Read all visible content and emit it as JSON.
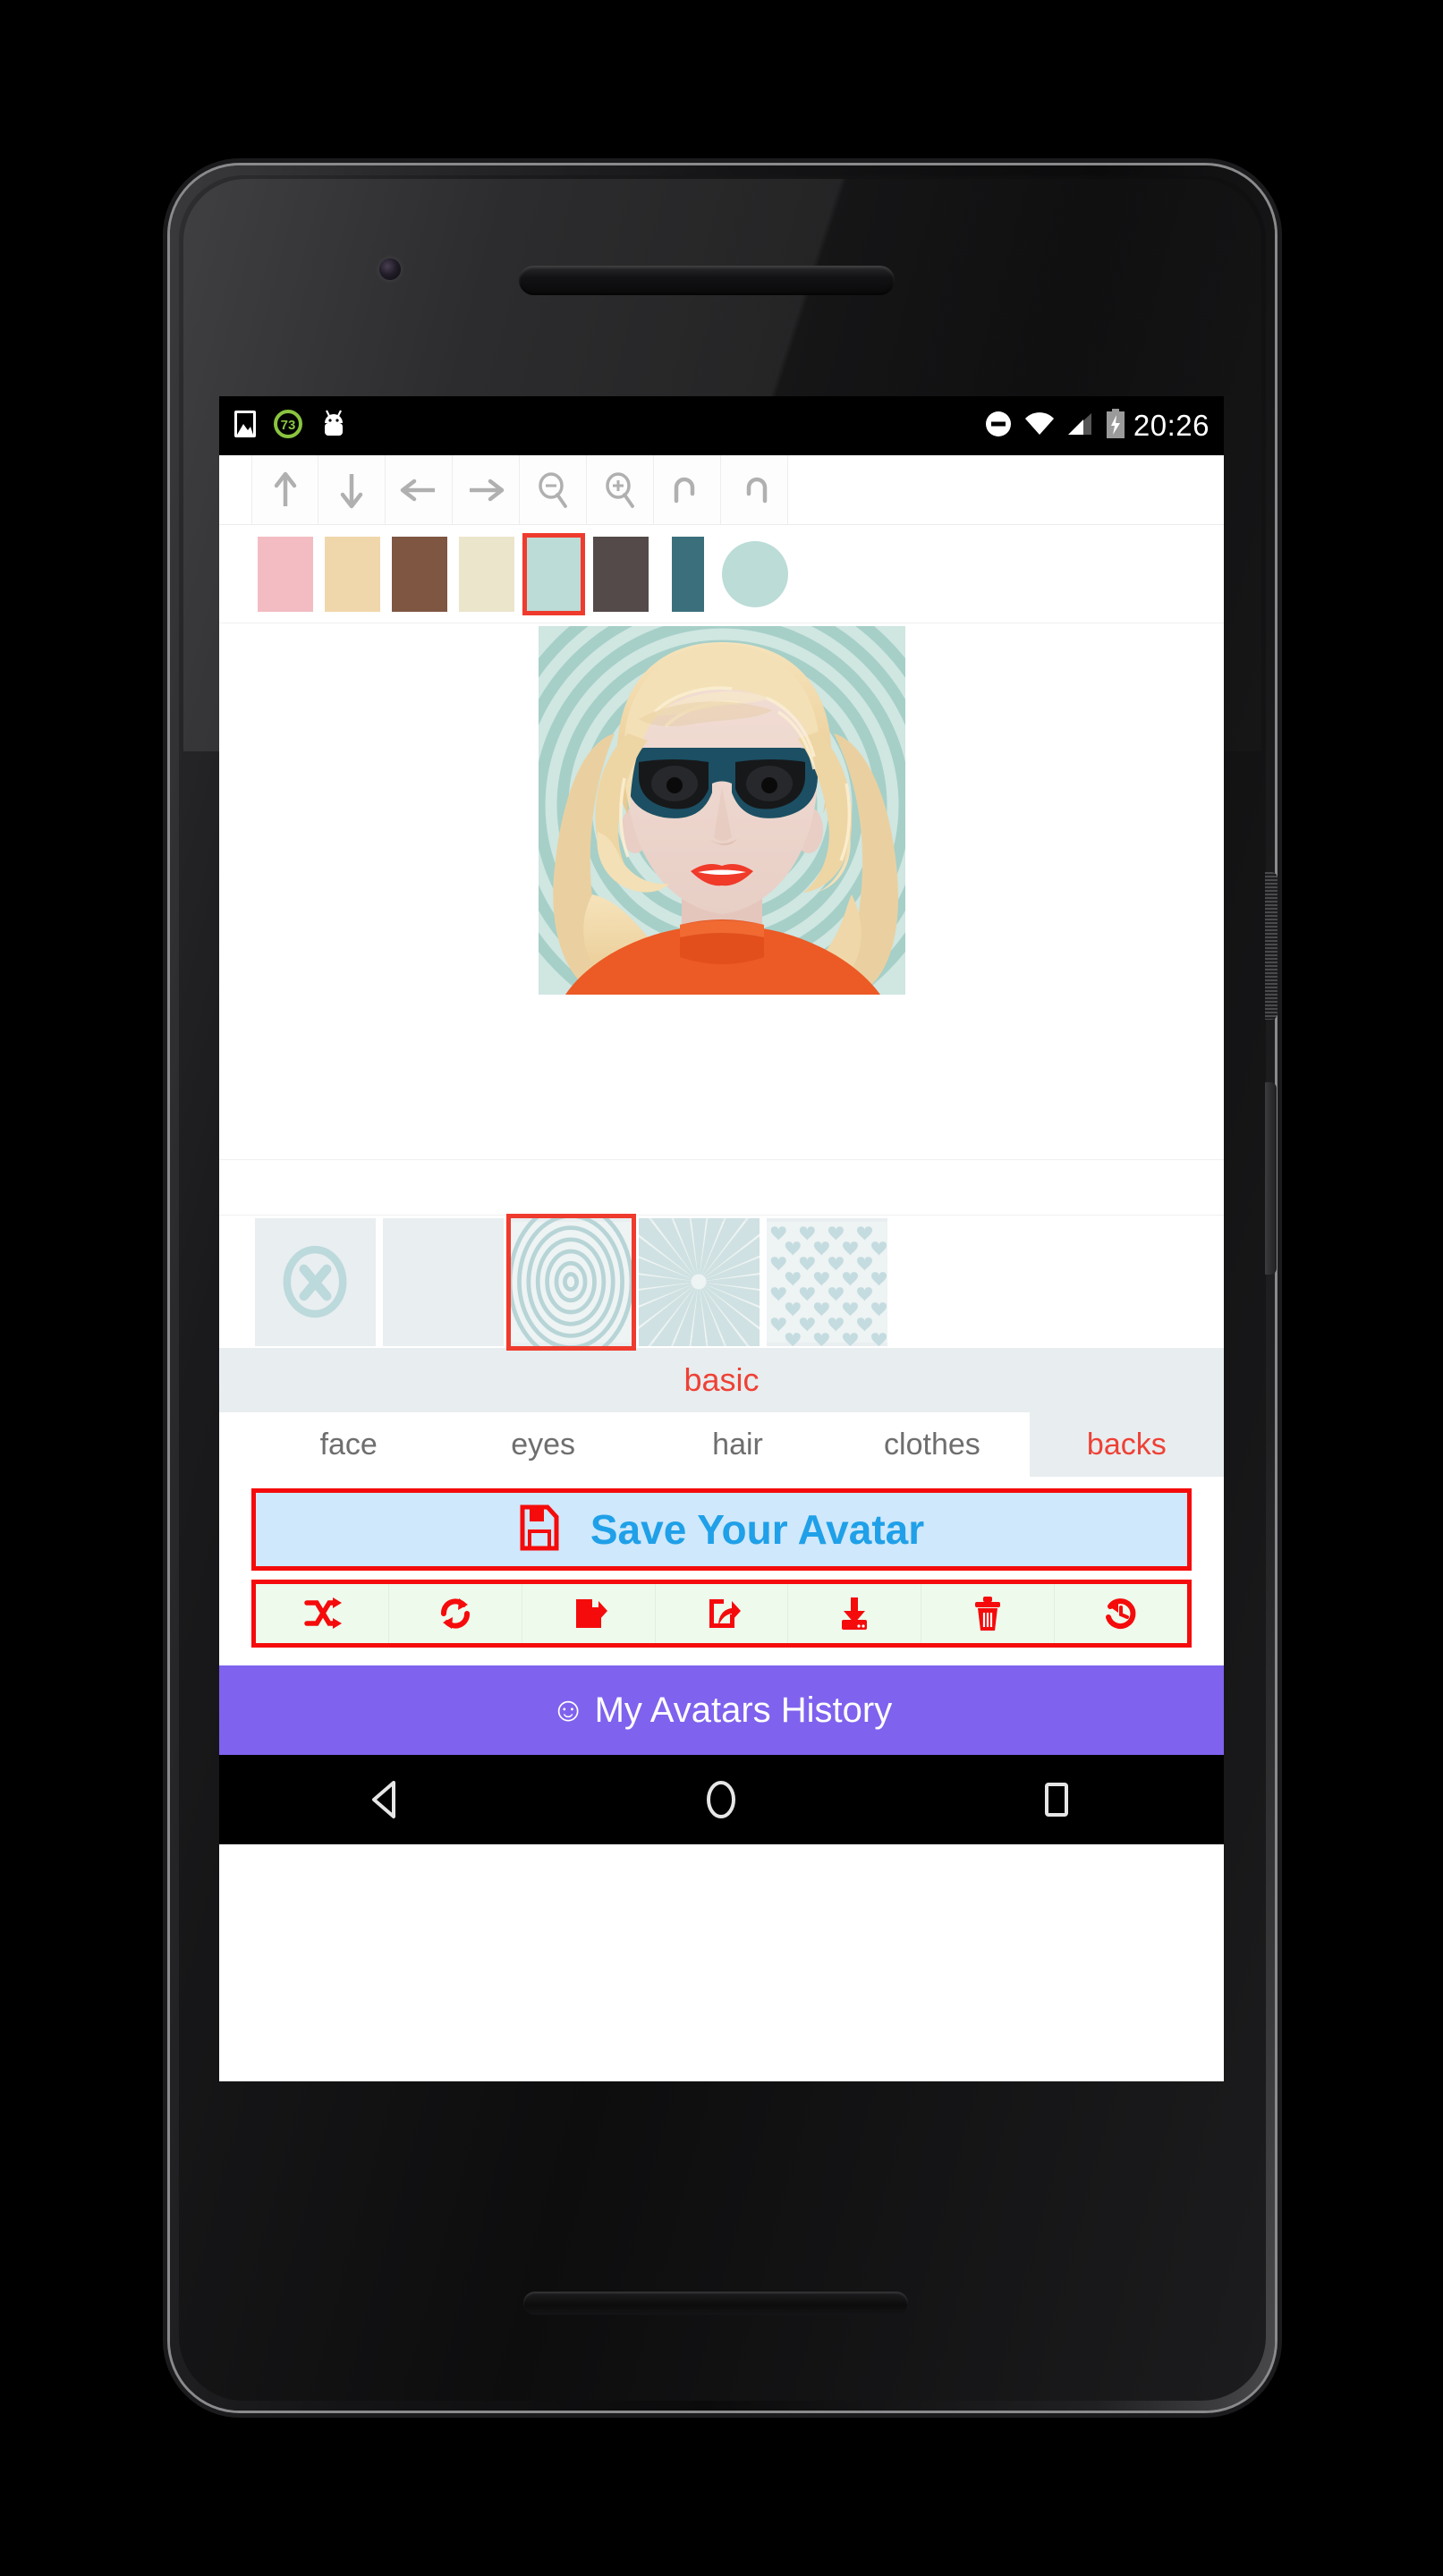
{
  "device": {
    "status_bar": {
      "time": "20:26",
      "left_icons": [
        "image-icon",
        "battery-saver-73-icon",
        "android-robot-icon"
      ],
      "battery_level": "73",
      "right_icons": [
        "do-not-disturb-icon",
        "wifi-icon",
        "cell-signal-icon",
        "battery-charging-icon"
      ]
    },
    "nav_bar": {
      "back": "back-triangle-icon",
      "home": "home-circle-icon",
      "recents": "recents-square-icon"
    }
  },
  "editor_toolbar": {
    "buttons": [
      {
        "name": "move-up",
        "icon": "arrow-up-icon"
      },
      {
        "name": "move-down",
        "icon": "arrow-down-icon"
      },
      {
        "name": "move-left",
        "icon": "arrow-left-icon"
      },
      {
        "name": "move-right",
        "icon": "arrow-right-icon"
      },
      {
        "name": "zoom-out",
        "icon": "magnifier-minus-icon"
      },
      {
        "name": "zoom-in",
        "icon": "magnifier-plus-icon"
      },
      {
        "name": "undo",
        "icon": "undo-icon"
      },
      {
        "name": "redo",
        "icon": "redo-icon"
      }
    ]
  },
  "color_palette": {
    "selected_index": 4,
    "current_color": "#bbdcd7",
    "swatches": [
      {
        "name": "pink",
        "hex": "#f2bcc2"
      },
      {
        "name": "tan",
        "hex": "#f0d7ab"
      },
      {
        "name": "brown",
        "hex": "#7e5642"
      },
      {
        "name": "cream",
        "hex": "#eae5cb"
      },
      {
        "name": "light-teal",
        "hex": "#bbdcd7"
      },
      {
        "name": "dark-gray",
        "hex": "#544a4a"
      },
      {
        "name": "teal",
        "hex": "#3c6f7c"
      }
    ]
  },
  "avatar": {
    "background_style": "concentric-rings",
    "background_color": "#b9dcd6",
    "hair_color": "#f0d7a6",
    "skin_color": "#efd9d0",
    "sunglasses_color": "#1c4f63",
    "lips_color": "#f03a2a",
    "shirt_color": "#ec5a25"
  },
  "background_thumbnails": {
    "selected_index": 2,
    "items": [
      {
        "name": "none",
        "icon": "circle-x-icon"
      },
      {
        "name": "solid",
        "icon": "solid-fill"
      },
      {
        "name": "rings",
        "icon": "concentric-rings"
      },
      {
        "name": "rays",
        "icon": "sunburst-rays"
      },
      {
        "name": "hearts",
        "icon": "hearts-pattern"
      }
    ]
  },
  "category": {
    "label": "basic"
  },
  "tabs": {
    "active": "backs",
    "items": [
      {
        "label": "face"
      },
      {
        "label": "eyes"
      },
      {
        "label": "hair"
      },
      {
        "label": "clothes"
      },
      {
        "label": "backs"
      }
    ]
  },
  "save_button": {
    "label": "Save Your Avatar",
    "icon": "floppy-disk-icon",
    "text_color": "#1fa0e8",
    "border_color": "#f50b0b",
    "background_color": "#cfe8fb"
  },
  "action_row": {
    "border_color": "#f50b0b",
    "background_color": "#edfaec",
    "icon_color": "#f50b0b",
    "buttons": [
      {
        "name": "shuffle",
        "icon": "shuffle-icon"
      },
      {
        "name": "randomize",
        "icon": "refresh-icon"
      },
      {
        "name": "share",
        "icon": "share-filled-icon"
      },
      {
        "name": "share-outline",
        "icon": "share-outline-icon"
      },
      {
        "name": "download",
        "icon": "download-icon"
      },
      {
        "name": "delete",
        "icon": "trash-icon"
      },
      {
        "name": "reset",
        "icon": "history-restore-icon"
      }
    ]
  },
  "history_banner": {
    "label": "My Avatars History",
    "icon": "smiley-icon",
    "background_color": "#7f62ee"
  }
}
